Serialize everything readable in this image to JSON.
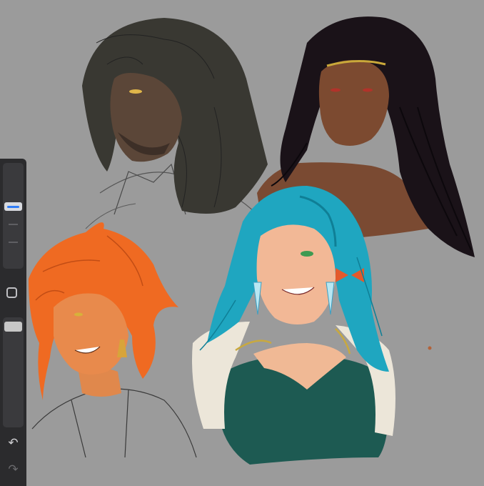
{
  "app": {
    "canvas_background": "#9b9b9b",
    "accent_color": "#2f7cf6"
  },
  "sidebar": {
    "brush_size_slider": {
      "icon": "brush-size-slider",
      "level": 0.4
    },
    "modify_button": {
      "icon": "square-outline-icon"
    },
    "opacity_slider": {
      "icon": "opacity-slider",
      "level": 0.96
    },
    "undo": {
      "glyph": "↶",
      "icon": "undo-icon"
    },
    "redo": {
      "glyph": "↷",
      "icon": "redo-icon"
    }
  },
  "artwork": {
    "subjects": [
      "dark-haired-bearded-man",
      "long-black-hair-woman",
      "orange-hair-man",
      "turquoise-hair-woman"
    ]
  }
}
